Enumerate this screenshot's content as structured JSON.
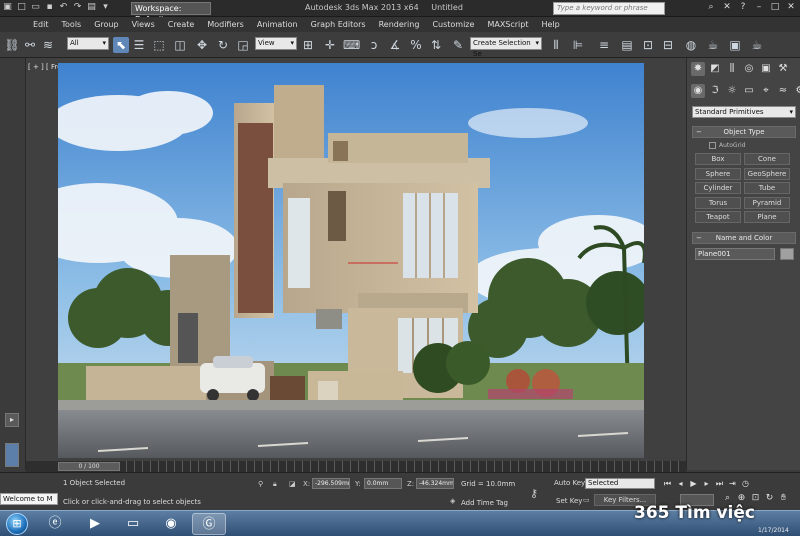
{
  "titlebar": {
    "workspace": "Workspace: Default",
    "app_name": "Autodesk 3ds Max  2013 x64",
    "doc_name": "Untitled",
    "search_placeholder": "Type a keyword or phrase"
  },
  "menu": [
    "Edit",
    "Tools",
    "Group",
    "Views",
    "Create",
    "Modifiers",
    "Animation",
    "Graph Editors",
    "Rendering",
    "Customize",
    "MAXScript",
    "Help"
  ],
  "toolbar": {
    "filter_value": "All",
    "ref_coord_value": "View",
    "selection_set_placeholder": "Create Selection Se"
  },
  "viewport": {
    "label": "[ + ] [ Front ] [ Realistic ]"
  },
  "command_panel": {
    "category_value": "Standard Primitives",
    "object_type_title": "Object Type",
    "autogrid_label": "AutoGrid",
    "primitives": [
      "Box",
      "Cone",
      "Sphere",
      "GeoSphere",
      "Cylinder",
      "Tube",
      "Torus",
      "Pyramid",
      "Teapot",
      "Plane"
    ],
    "name_color_title": "Name and Color",
    "object_name": "Plane001"
  },
  "timeline": {
    "frame_display": "0 / 100"
  },
  "status": {
    "selected_text": "1 Object Selected",
    "prompt_text": "Click or click-and-drag to select objects",
    "x_label": "X:",
    "x_value": "-296.509mm",
    "y_label": "Y:",
    "y_value": "0.0mm",
    "z_label": "Z:",
    "z_value": "-46.324mm",
    "grid_text": "Grid = 10.0mm",
    "add_time_tag": "Add Time Tag",
    "auto_key": "Auto Key",
    "set_key": "Set Key",
    "selected_mode": "Selected",
    "key_filters": "Key Filters...",
    "maxscript_text": "Welcome to M"
  },
  "watermark": {
    "brand": "365",
    "slogan": "Tìm việc"
  },
  "tray": {
    "date": "1/17/2014"
  }
}
